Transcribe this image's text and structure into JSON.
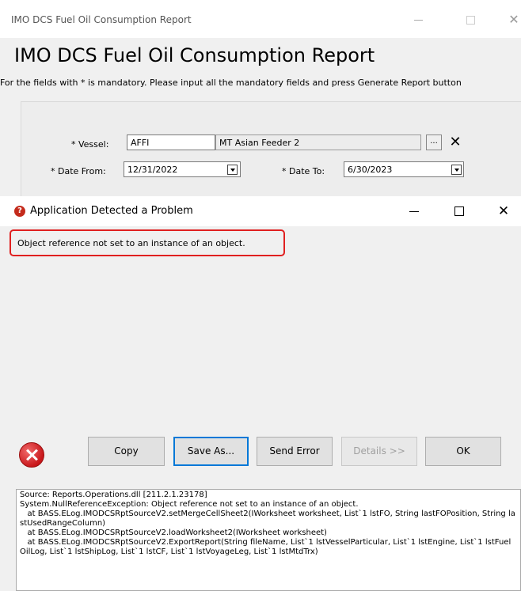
{
  "main_window": {
    "title": "IMO DCS Fuel Oil Consumption Report",
    "close_glyph": "✕",
    "report_title": "IMO DCS Fuel Oil Consumption Report",
    "instructions": "For the fields with * is mandatory. Please input all the mandatory fields and press Generate Report button",
    "form": {
      "vessel_label": "* Vessel:",
      "vessel_code": "AFFI",
      "vessel_name": "MT Asian Feeder 2",
      "browse_label": "...",
      "clear_glyph": "✕",
      "date_from_label": "* Date From:",
      "date_from_value": "12/31/2022",
      "date_to_label": "* Date To:",
      "date_to_value": "6/30/2023"
    }
  },
  "dialog": {
    "title": "Application Detected a Problem",
    "icon_glyph": "?",
    "close_glyph": "✕",
    "message": "Object reference not set to an instance of an object.",
    "buttons": {
      "copy": "Copy",
      "save_as": "Save As...",
      "send_error": "Send Error",
      "details": "Details >>",
      "ok": "OK"
    },
    "details_text": "Source: Reports.Operations.dll [211.2.1.23178]\nSystem.NullReferenceException: Object reference not set to an instance of an object.\n   at BASS.ELog.IMODCSRptSourceV2.setMergeCellSheet2(IWorksheet worksheet, List`1 lstFO, String lastFOPosition, String lastUsedRangeColumn)\n   at BASS.ELog.IMODCSRptSourceV2.loadWorksheet2(IWorksheet worksheet)\n   at BASS.ELog.IMODCSRptSourceV2.ExportReport(String fileName, List`1 lstVesselParticular, List`1 lstEngine, List`1 lstFuelOilLog, List`1 lstShipLog, List`1 lstCF, List`1 lstVoyageLeg, List`1 lstMtdTrx)"
  }
}
